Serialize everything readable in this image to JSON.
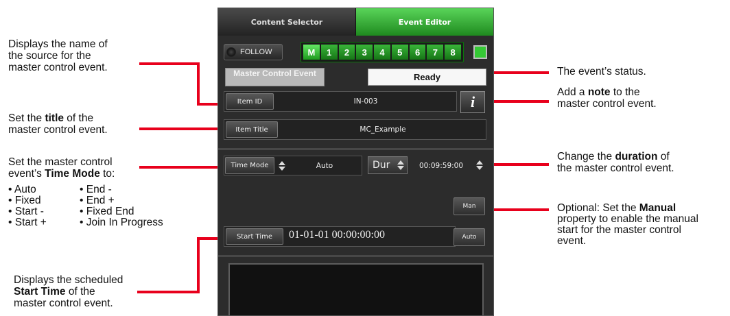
{
  "annotations": {
    "source_name": [
      "Displays the name of",
      "the source for the",
      "master control event."
    ],
    "title": {
      "pre": "Set the ",
      "bold": "title",
      "post": " of the",
      "line2": "master control event."
    },
    "time_mode": {
      "line1": "Set the master control",
      "pre": "event’s ",
      "bold": "Time Mode",
      "post": " to:"
    },
    "time_modes_left": [
      "• Auto",
      "• Fixed",
      "• Start -",
      "• Start +"
    ],
    "time_modes_right": [
      "• End -",
      "• End +",
      "• Fixed End",
      "• Join In Progress"
    ],
    "start_time": {
      "line1": "Displays the scheduled",
      "bold": "Start Time",
      "post": " of the",
      "line3": "master control event."
    },
    "status": "The event’s status.",
    "note": {
      "pre": "Add a ",
      "bold": "note",
      "post": " to the",
      "line2": "master control event."
    },
    "duration": {
      "pre": "Change the ",
      "bold": "duration",
      "post": " of",
      "line2": "the master control event."
    },
    "manual": {
      "pre": "Optional: Set the ",
      "bold": "Manual",
      "line2": "property to enable the manual",
      "line3": "start for the master control",
      "line4": "event."
    }
  },
  "panel": {
    "tabs": [
      "Content Selector",
      "Event Editor"
    ],
    "follow_label": "FOLLOW",
    "channels": [
      "M",
      "1",
      "2",
      "3",
      "4",
      "5",
      "6",
      "7",
      "8"
    ],
    "mce_label": "Master Control Event",
    "status": "Ready",
    "item_id_label": "Item ID",
    "item_id_value": "IN-003",
    "info_glyph": "i",
    "item_title_label": "Item Title",
    "item_title_value": "MC_Example",
    "time_mode_label": "Time Mode",
    "time_mode_value": "Auto",
    "dur_label": "Dur",
    "dur_value": "00:09:59:00",
    "man_label": "Man",
    "start_time_label": "Start Time",
    "start_time_value": "01-01-01 00:00:00:00",
    "auto_label": "Auto"
  },
  "colors": {
    "accent_green": "#35c935",
    "callout_red": "#e8001c",
    "panel_bg": "#2c2c2c"
  },
  "icons": [
    "info-icon",
    "spinner-icon",
    "led-icon"
  ]
}
